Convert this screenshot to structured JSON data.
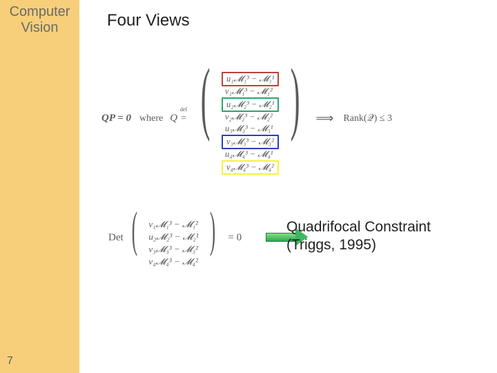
{
  "sidebar": {
    "title_line1": "Computer",
    "title_line2": "Vision",
    "page_number": "7"
  },
  "slide": {
    "title": "Four Views",
    "eq1": {
      "lhs": "QP = 0",
      "where": "where",
      "Q": "Q",
      "defrel": "=",
      "deflabel": "def",
      "rows": [
        "u₁𝓜₁³ − 𝓜₁¹",
        "v₁𝓜₁³ − 𝓜₁²",
        "u₂𝓜₂³ − 𝓜₂¹",
        "v₂𝓜₂³ − 𝓜₂²",
        "u₃𝓜₃³ − 𝓜₃¹",
        "v₃𝓜₃³ − 𝓜₃²",
        "u₄𝓜₄³ − 𝓜₄¹",
        "v₄𝓜₄³ − 𝓜₄²"
      ],
      "row_highlight": [
        "box-red",
        "",
        "box-green",
        "",
        "",
        "box-blue",
        "",
        "box-yel"
      ],
      "implies": "⟹",
      "rank": "Rank(𝒬) ≤ 3"
    },
    "eq2": {
      "det": "Det",
      "rows": [
        "v₁𝓜₁³ − 𝓜₁²",
        "u₂𝓜₂³ − 𝓜₂¹",
        "v₃𝓜₃³ − 𝓜₃²",
        "v₄𝓜₄³ − 𝓜₄²"
      ],
      "eqzero": "= 0"
    },
    "annotation": {
      "line1": "Quadrifocal Constraint",
      "line2": "(Triggs, 1995)"
    }
  },
  "colors": {
    "sidebar": "#f7cf7a",
    "highlight_red": "#b8433a",
    "highlight_green": "#2fa36e",
    "highlight_blue": "#2a3fbf",
    "highlight_yellow": "#f4f43a",
    "arrow": "#3fb760"
  }
}
